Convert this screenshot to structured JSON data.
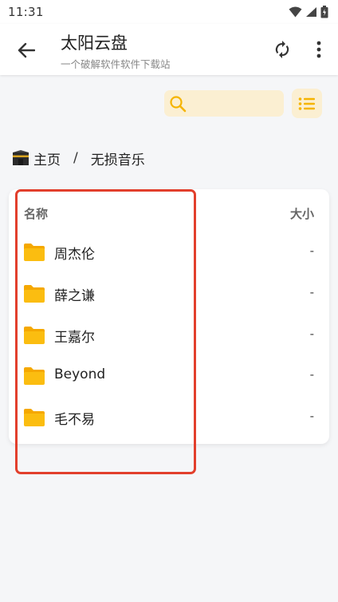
{
  "status_bar": {
    "time": "11:31"
  },
  "app_bar": {
    "title": "太阳云盘",
    "subtitle": "一个破解软件软件下载站"
  },
  "search": {
    "value": "",
    "placeholder": ""
  },
  "breadcrumb": {
    "home_icon": "kaaba-emoji",
    "home": "主页",
    "separator": "/",
    "current": "无损音乐"
  },
  "table": {
    "header_name": "名称",
    "header_size": "大小",
    "rows": [
      {
        "name": "周杰伦",
        "size": "-"
      },
      {
        "name": "薛之谦",
        "size": "-"
      },
      {
        "name": "王嘉尔",
        "size": "-"
      },
      {
        "name": "Beyond",
        "size": "-"
      },
      {
        "name": "毛不易",
        "size": "-"
      }
    ]
  },
  "colors": {
    "accent": "#f5b400",
    "search_bg": "#fbefd2",
    "highlight": "#e23f2c",
    "folder": "#fbbd10"
  }
}
